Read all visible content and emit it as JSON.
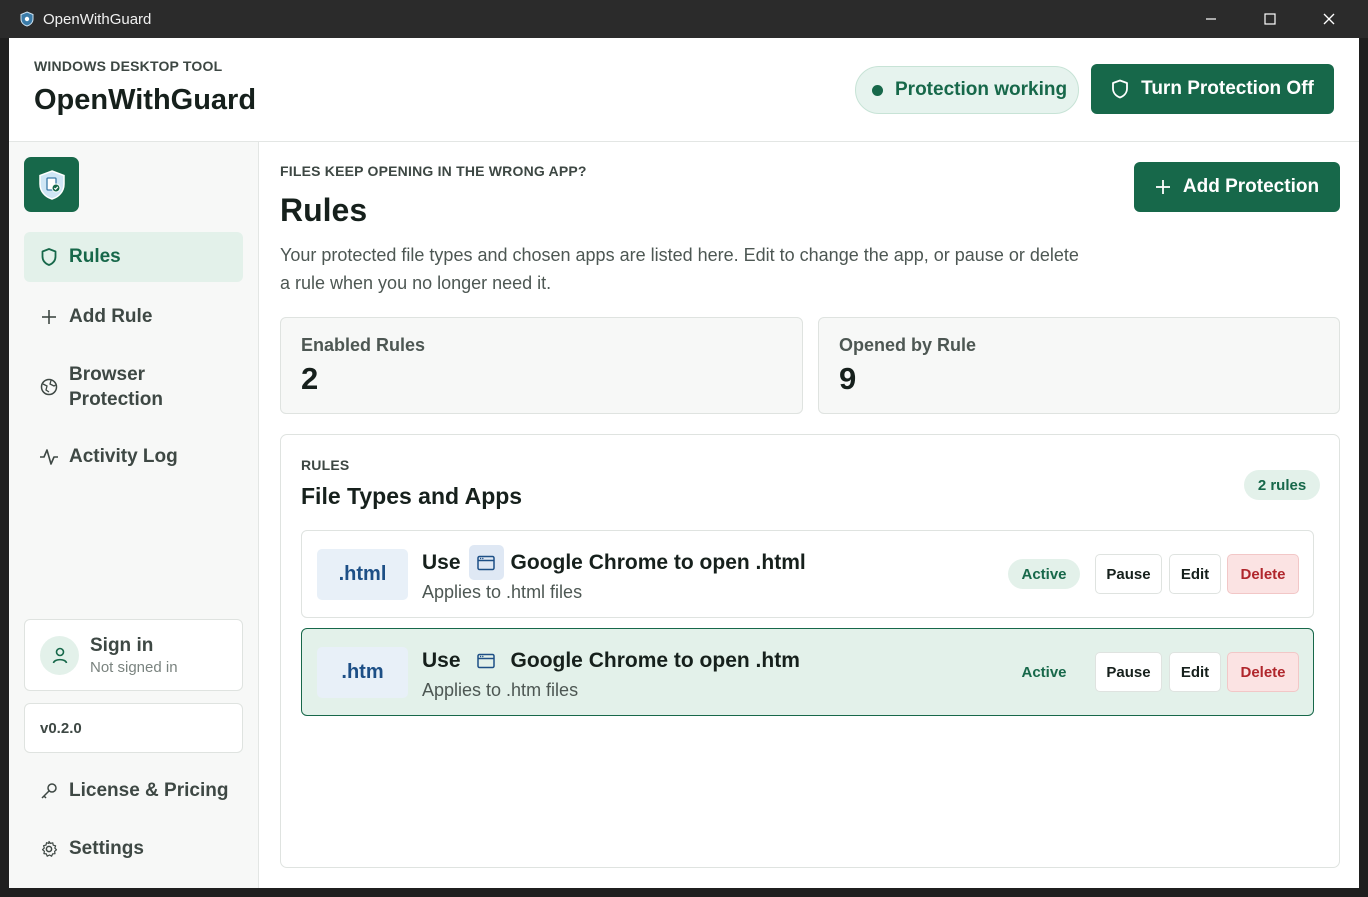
{
  "window": {
    "title": "OpenWithGuard"
  },
  "header": {
    "eyebrow": "WINDOWS DESKTOP TOOL",
    "app_title": "OpenWithGuard",
    "status": "Protection working",
    "toggle_button": "Turn Protection Off"
  },
  "sidebar": {
    "nav": [
      {
        "label": "Rules",
        "icon": "shield-icon",
        "active": true
      },
      {
        "label": "Add Rule",
        "icon": "plus-icon"
      },
      {
        "label": "Browser Protection",
        "icon": "globe-icon"
      },
      {
        "label": "Activity Log",
        "icon": "activity-icon"
      }
    ],
    "signin": {
      "title": "Sign in",
      "status": "Not signed in"
    },
    "version": "v0.2.0",
    "bottom": [
      {
        "label": "License & Pricing",
        "icon": "key-icon"
      },
      {
        "label": "Settings",
        "icon": "gear-icon"
      }
    ]
  },
  "main": {
    "eyebrow": "FILES KEEP OPENING IN THE WRONG APP?",
    "title": "Rules",
    "description": "Your protected file types and chosen apps are listed here. Edit to change the app, or pause or delete a rule when you no longer need it.",
    "add_button": "Add Protection",
    "stats": [
      {
        "label": "Enabled Rules",
        "value": "2"
      },
      {
        "label": "Opened by Rule",
        "value": "9"
      }
    ],
    "panel": {
      "eyebrow": "RULES",
      "title": "File Types and Apps",
      "count": "2 rules",
      "rules": [
        {
          "ext": ".html",
          "use": "Use",
          "app": "Google Chrome",
          "to_open": "to open .html",
          "sub": "Applies to .html files",
          "status": "Active",
          "pause": "Pause",
          "edit": "Edit",
          "delete": "Delete"
        },
        {
          "ext": ".htm",
          "use": "Use",
          "app": "Google Chrome",
          "to_open": "to open .htm",
          "sub": "Applies to .htm files",
          "status": "Active",
          "pause": "Pause",
          "edit": "Edit",
          "delete": "Delete"
        }
      ]
    }
  },
  "colors": {
    "accent": "#17684a",
    "danger": "#b0262c",
    "ext_chip": "#1d4f86"
  }
}
